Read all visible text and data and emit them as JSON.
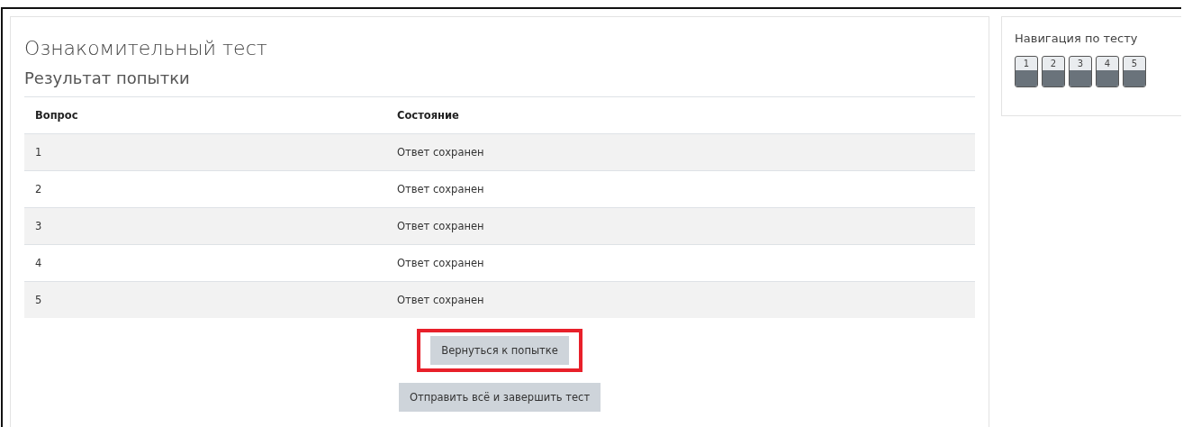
{
  "main": {
    "title": "Ознакомительный тест",
    "subtitle": "Результат попытки",
    "table": {
      "columns": [
        "Вопрос",
        "Состояние"
      ],
      "rows": [
        {
          "cells": [
            "1",
            "Ответ сохранен"
          ]
        },
        {
          "cells": [
            "2",
            "Ответ сохранен"
          ]
        },
        {
          "cells": [
            "3",
            "Ответ сохранен"
          ]
        },
        {
          "cells": [
            "4",
            "Ответ сохранен"
          ]
        },
        {
          "cells": [
            "5",
            "Ответ сохранен"
          ]
        }
      ]
    },
    "buttons": [
      {
        "label": "Вернуться к попытке",
        "highlighted": true
      },
      {
        "label": "Отправить всё и завершить тест",
        "highlighted": false
      }
    ]
  },
  "navigation": {
    "title": "Навигация по тесту",
    "questions": [
      {
        "label": "1",
        "answered": true
      },
      {
        "label": "2",
        "answered": true
      },
      {
        "label": "3",
        "answered": true
      },
      {
        "label": "4",
        "answered": true
      },
      {
        "label": "5",
        "answered": true
      }
    ]
  }
}
